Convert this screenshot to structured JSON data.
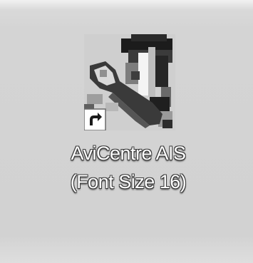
{
  "desktop": {
    "shortcut": {
      "label_line1": "AviCentre AIS",
      "label_line2": "(Font Size 16)",
      "icon": "wrench-screwdriver-app-icon",
      "overlay_icon": "shortcut-arrow-icon"
    }
  },
  "colors": {
    "background": "#d4d4d4",
    "label_text": "#ffffff",
    "label_outline": "#3a3a3a"
  }
}
